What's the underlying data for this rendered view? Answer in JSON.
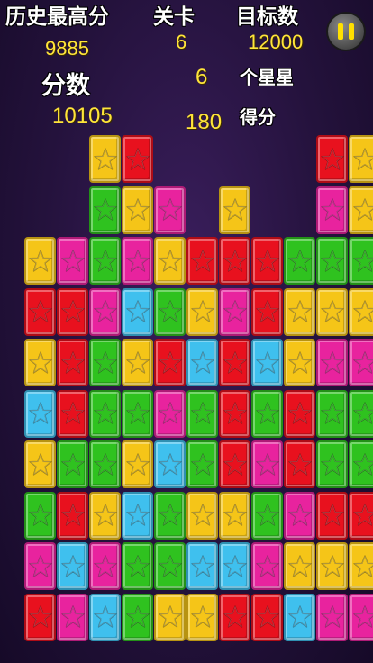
{
  "hud": {
    "best_label": "历史最高分",
    "best_value": "9885",
    "level_label": "关卡",
    "level_value": "6",
    "target_label": "目标数",
    "target_value": "12000",
    "score_label": "分数",
    "score_value": "10105",
    "stars_count": "6",
    "stars_label": "个星星",
    "points_value": "180",
    "points_label": "得分"
  },
  "colors": {
    "Y": "#f5c518",
    "R": "#e8111e",
    "G": "#2fc21f",
    "P": "#e8239e",
    "B": "#3fc0ee"
  },
  "board": {
    "columns": 11,
    "rows": 10,
    "grid": [
      "..YR.....RY",
      "..GYP.Y..PY",
      "YPGPYRRRGGG",
      "RRPBGYPRYYY",
      "YRGYRBRBYPP",
      "BRGGPGRGRGG",
      "YGGYBGRPRGG",
      "GRYBGYYGPRR",
      "PBPGGBBPYYY",
      "RPBGYYRRBPP"
    ]
  }
}
